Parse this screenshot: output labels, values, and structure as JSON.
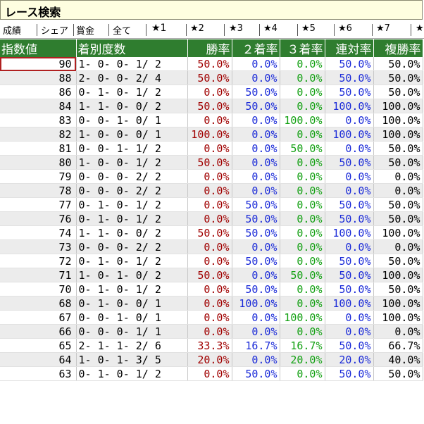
{
  "window": {
    "title": "レース検索"
  },
  "tabs": [
    {
      "label": "成績"
    },
    {
      "label": "シェア"
    },
    {
      "label": "賞金"
    },
    {
      "label": "全て"
    },
    {
      "label": "★1"
    },
    {
      "label": "★2"
    },
    {
      "label": "★3"
    },
    {
      "label": "★4"
    },
    {
      "label": "★5"
    },
    {
      "label": "★6"
    },
    {
      "label": "★7"
    },
    {
      "label": "★"
    }
  ],
  "selected_tab": "★1",
  "columns": [
    "指数値",
    "着別度数",
    "勝率",
    "２着率",
    "３着率",
    "連対率",
    "複勝率"
  ],
  "colors": {
    "win": "#a00000",
    "second": "#1a2ad8",
    "third": "#12a012",
    "rentai": "#1a2ad8",
    "fukusho": "#000000",
    "header_bg": "#2f7d2f"
  },
  "rows": [
    [
      "90",
      "1- 0- 0- 1/ 2",
      "50.0%",
      "0.0%",
      "0.0%",
      "50.0%",
      "50.0%"
    ],
    [
      "88",
      "2- 0- 0- 2/ 4",
      "50.0%",
      "0.0%",
      "0.0%",
      "50.0%",
      "50.0%"
    ],
    [
      "86",
      "0- 1- 0- 1/ 2",
      "0.0%",
      "50.0%",
      "0.0%",
      "50.0%",
      "50.0%"
    ],
    [
      "84",
      "1- 1- 0- 0/ 2",
      "50.0%",
      "50.0%",
      "0.0%",
      "100.0%",
      "100.0%"
    ],
    [
      "83",
      "0- 0- 1- 0/ 1",
      "0.0%",
      "0.0%",
      "100.0%",
      "0.0%",
      "100.0%"
    ],
    [
      "82",
      "1- 0- 0- 0/ 1",
      "100.0%",
      "0.0%",
      "0.0%",
      "100.0%",
      "100.0%"
    ],
    [
      "81",
      "0- 0- 1- 1/ 2",
      "0.0%",
      "0.0%",
      "50.0%",
      "0.0%",
      "50.0%"
    ],
    [
      "80",
      "1- 0- 0- 1/ 2",
      "50.0%",
      "0.0%",
      "0.0%",
      "50.0%",
      "50.0%"
    ],
    [
      "79",
      "0- 0- 0- 2/ 2",
      "0.0%",
      "0.0%",
      "0.0%",
      "0.0%",
      "0.0%"
    ],
    [
      "78",
      "0- 0- 0- 2/ 2",
      "0.0%",
      "0.0%",
      "0.0%",
      "0.0%",
      "0.0%"
    ],
    [
      "77",
      "0- 1- 0- 1/ 2",
      "0.0%",
      "50.0%",
      "0.0%",
      "50.0%",
      "50.0%"
    ],
    [
      "76",
      "0- 1- 0- 1/ 2",
      "0.0%",
      "50.0%",
      "0.0%",
      "50.0%",
      "50.0%"
    ],
    [
      "74",
      "1- 1- 0- 0/ 2",
      "50.0%",
      "50.0%",
      "0.0%",
      "100.0%",
      "100.0%"
    ],
    [
      "73",
      "0- 0- 0- 2/ 2",
      "0.0%",
      "0.0%",
      "0.0%",
      "0.0%",
      "0.0%"
    ],
    [
      "72",
      "0- 1- 0- 1/ 2",
      "0.0%",
      "50.0%",
      "0.0%",
      "50.0%",
      "50.0%"
    ],
    [
      "71",
      "1- 0- 1- 0/ 2",
      "50.0%",
      "0.0%",
      "50.0%",
      "50.0%",
      "100.0%"
    ],
    [
      "70",
      "0- 1- 0- 1/ 2",
      "0.0%",
      "50.0%",
      "0.0%",
      "50.0%",
      "50.0%"
    ],
    [
      "68",
      "0- 1- 0- 0/ 1",
      "0.0%",
      "100.0%",
      "0.0%",
      "100.0%",
      "100.0%"
    ],
    [
      "67",
      "0- 0- 1- 0/ 1",
      "0.0%",
      "0.0%",
      "100.0%",
      "0.0%",
      "100.0%"
    ],
    [
      "66",
      "0- 0- 0- 1/ 1",
      "0.0%",
      "0.0%",
      "0.0%",
      "0.0%",
      "0.0%"
    ],
    [
      "65",
      "2- 1- 1- 2/ 6",
      "33.3%",
      "16.7%",
      "16.7%",
      "50.0%",
      "66.7%"
    ],
    [
      "64",
      "1- 0- 1- 3/ 5",
      "20.0%",
      "0.0%",
      "20.0%",
      "20.0%",
      "40.0%"
    ],
    [
      "63",
      "0- 1- 0- 1/ 2",
      "0.0%",
      "50.0%",
      "0.0%",
      "50.0%",
      "50.0%"
    ]
  ]
}
